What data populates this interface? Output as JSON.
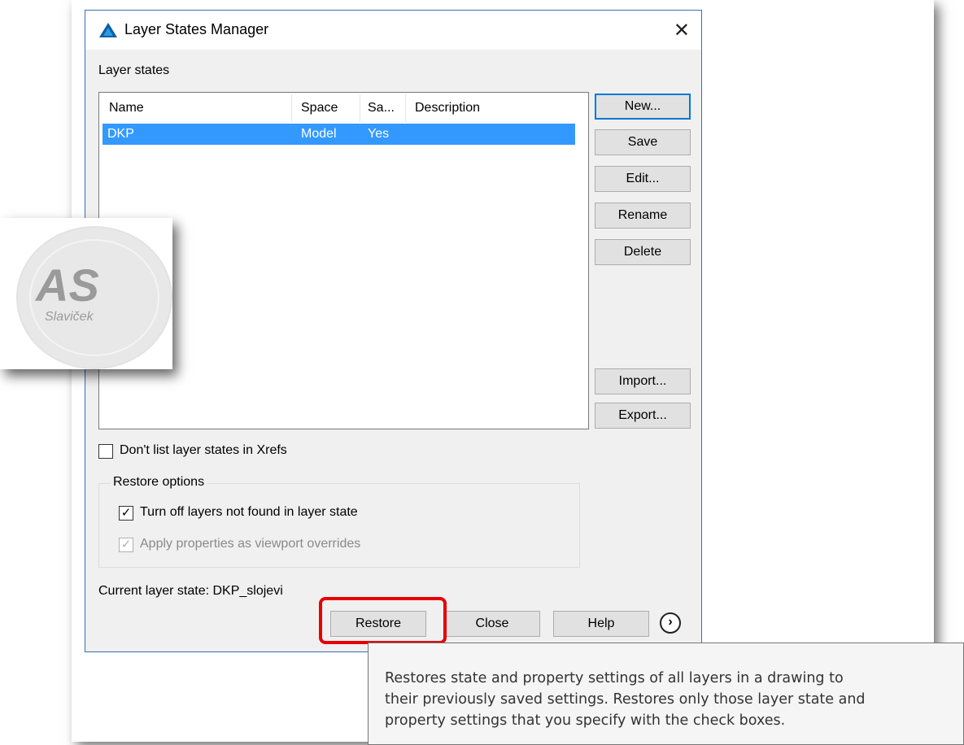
{
  "dialog": {
    "title": "Layer States Manager",
    "section_label": "Layer states",
    "columns": [
      "Name",
      "Space",
      "Sa...",
      "Description"
    ],
    "rows": [
      {
        "name": "DKP",
        "space": "Model",
        "saved": "Yes",
        "description": ""
      }
    ],
    "buttons": {
      "new": "New...",
      "save": "Save",
      "edit": "Edit...",
      "rename": "Rename",
      "delete": "Delete",
      "import": "Import...",
      "export": "Export...",
      "restore": "Restore",
      "close": "Close",
      "help": "Help"
    },
    "dont_list_xrefs": {
      "label": "Don't list layer states in Xrefs",
      "checked": false
    },
    "restore_options": {
      "legend": "Restore options",
      "turn_off": {
        "label": "Turn off layers not found in layer state",
        "checked": true
      },
      "apply_vp": {
        "label": "Apply properties as viewport overrides",
        "checked": true,
        "disabled": true
      }
    },
    "current_state": "Current layer state: DKP_slojevi"
  },
  "watermark": {
    "initials": "AS",
    "name": "Slaviček"
  },
  "tooltip": {
    "lines": [
      "Restores state and property settings of all layers in a drawing to",
      "their previously saved settings. Restores only those layer state and",
      "property settings that you specify with the check boxes."
    ]
  },
  "colors": {
    "selection": "#3399ff",
    "highlight": "#e60000",
    "accent": "#0078d7"
  }
}
